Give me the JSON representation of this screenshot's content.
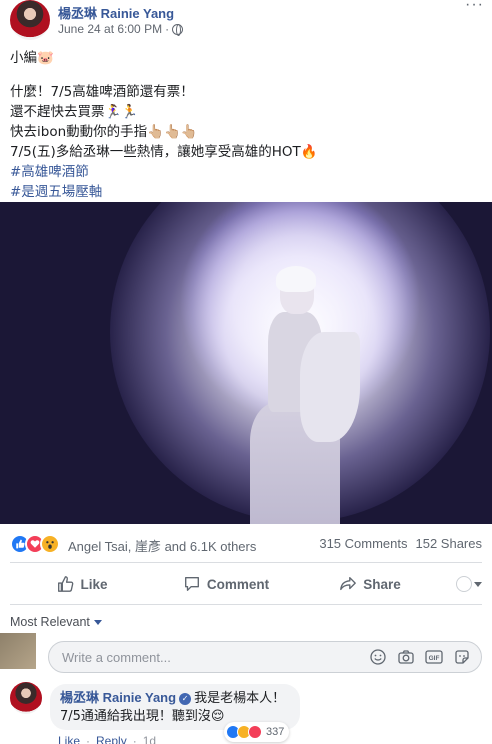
{
  "post": {
    "author": "楊丞琳 Rainie Yang",
    "date": "June 24 at 6:00 PM",
    "date_separator": "·",
    "more_label": "···",
    "text_lines": [
      "小編🐷",
      "什麼！7/5高雄啤酒節還有票！",
      "還不趕快去買票🏃‍♀️🏃",
      "快去ibon動動你的手指👆🏼👆🏼👆🏼",
      "7/5(五)多給丞琳一些熱情，讓她享受高雄的HOT🔥"
    ],
    "hashtags": [
      "#高雄啤酒節",
      "#是週五場壓軸"
    ]
  },
  "reactions": {
    "names": "Angel Tsai, 崖彥 and 6.1K others",
    "comments": "315 Comments",
    "shares": "152 Shares"
  },
  "actions": {
    "like_label": "Like",
    "comment_label": "Comment",
    "share_label": "Share"
  },
  "comments_section": {
    "sort_label": "Most Relevant",
    "input_placeholder": "Write a comment..."
  },
  "top_comment": {
    "author": "楊丞琳 Rainie Yang",
    "text": "我是老楊本人！ 7/5通通給我出現！聽到沒😌",
    "reaction_count": "337",
    "like_label": "Like",
    "reply_label": "Reply",
    "separator": "·",
    "time": "1d"
  },
  "colors": {
    "link": "#385898",
    "like": "#2078f4",
    "love": "#f33e58",
    "wow": "#f7b125"
  }
}
